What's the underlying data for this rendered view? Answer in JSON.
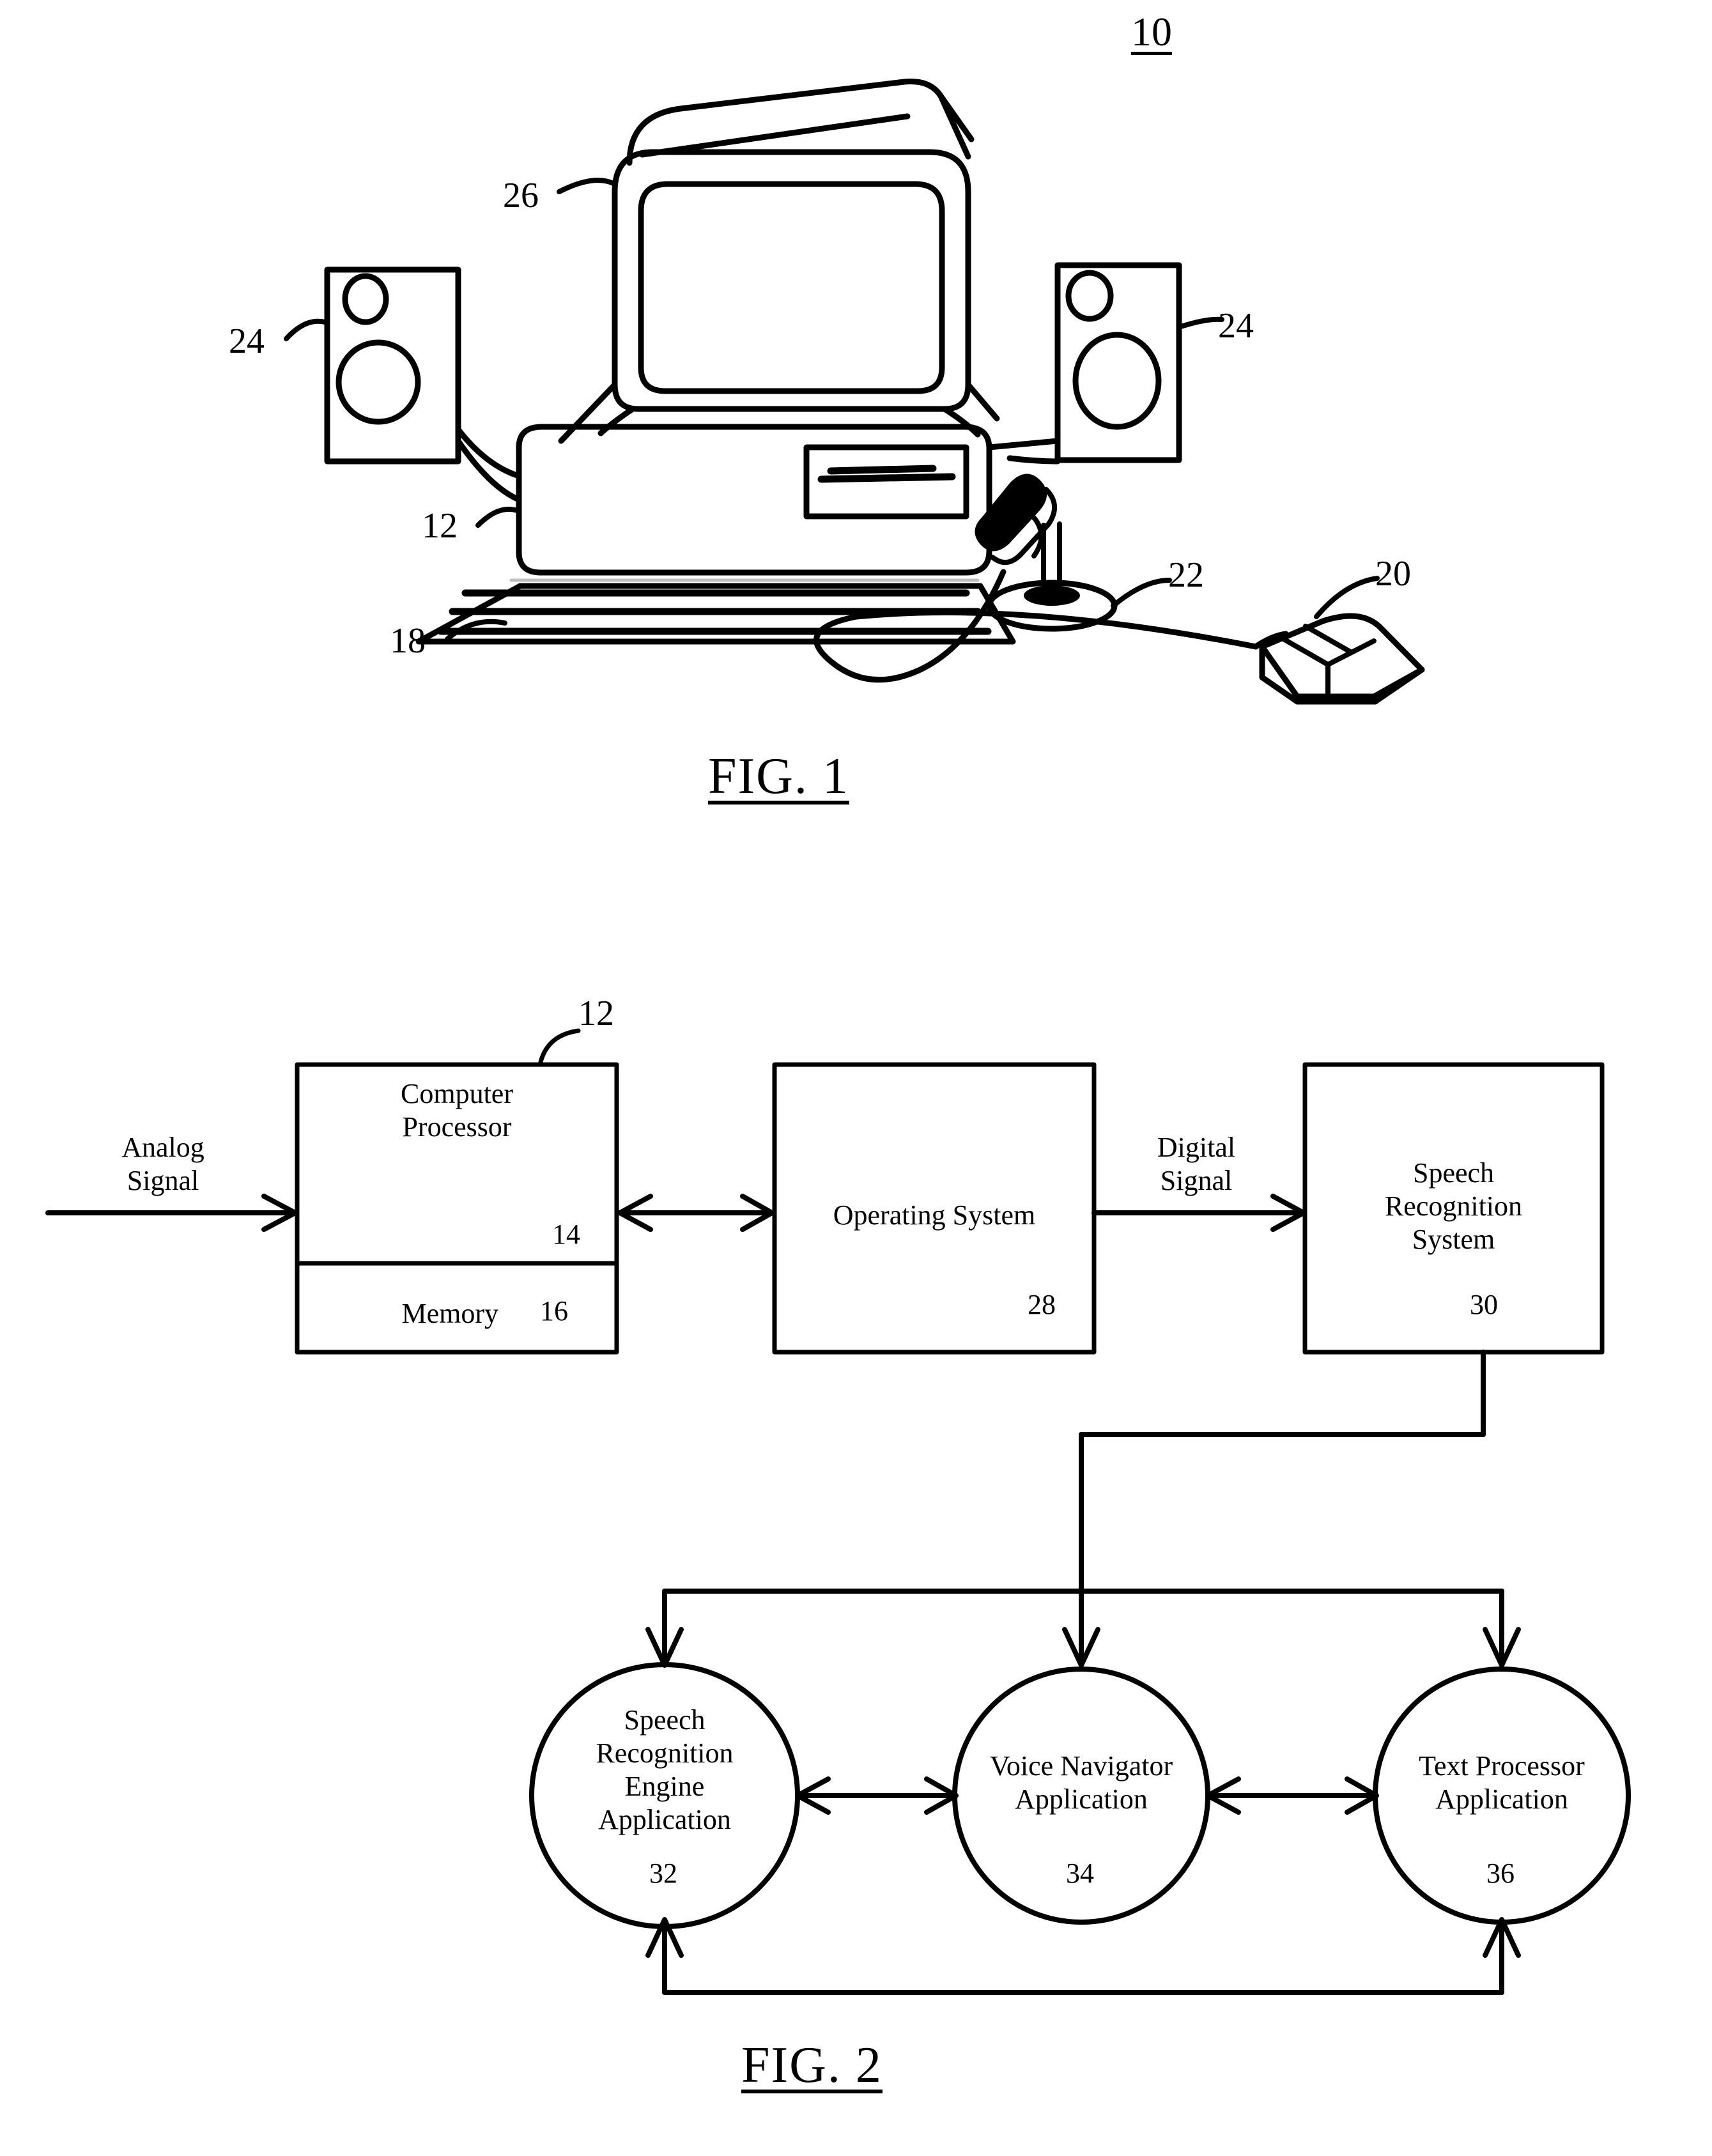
{
  "figure_1": {
    "system_numeral": "10",
    "caption": "FIG. 1",
    "callouts": [
      {
        "numeral": "26",
        "target": "monitor"
      },
      {
        "numeral": "24",
        "target": "left-speaker"
      },
      {
        "numeral": "24",
        "target": "right-speaker"
      },
      {
        "numeral": "12",
        "target": "computer-chassis"
      },
      {
        "numeral": "18",
        "target": "keyboard"
      },
      {
        "numeral": "22",
        "target": "microphone"
      },
      {
        "numeral": "20",
        "target": "mouse"
      }
    ],
    "parts": {
      "monitor": "26",
      "left_speaker": "24",
      "right_speaker": "24",
      "computer": "12",
      "keyboard": "18",
      "microphone": "22",
      "mouse": "20"
    }
  },
  "figure_2": {
    "caption": "FIG. 2",
    "inputs": {
      "analog_signal": "Analog\nSignal",
      "digital_signal": "Digital\nSignal"
    },
    "blocks": [
      {
        "id": "computer-processor",
        "label": "Computer\nProcessor",
        "numeral": "14",
        "outer_numeral": "12"
      },
      {
        "id": "memory",
        "label": "Memory",
        "numeral": "16"
      },
      {
        "id": "operating-system",
        "label": "Operating System",
        "numeral": "28"
      },
      {
        "id": "speech-recognition-system",
        "label": "Speech\nRecognition\nSystem",
        "numeral": "30"
      }
    ],
    "applications": [
      {
        "id": "speech-recognition-engine-application",
        "label": "Speech\nRecognition\nEngine\nApplication",
        "numeral": "32"
      },
      {
        "id": "voice-navigator-application",
        "label": "Voice Navigator\nApplication",
        "numeral": "34"
      },
      {
        "id": "text-processor-application",
        "label": "Text Processor\nApplication",
        "numeral": "36"
      }
    ]
  },
  "style": {
    "ink": "#000000",
    "paper": "#ffffff"
  }
}
